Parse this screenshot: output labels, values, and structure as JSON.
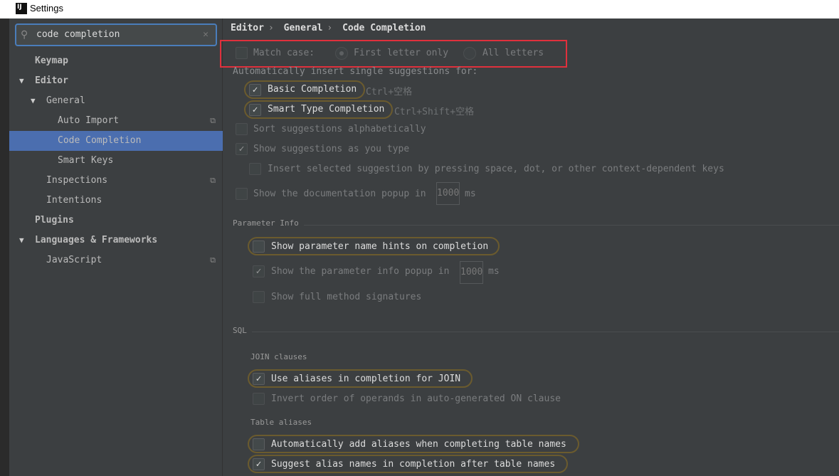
{
  "window": {
    "title": "Settings",
    "logo": "IJ"
  },
  "search": {
    "value": "code completion",
    "icon": "search-icon",
    "clear_icon": "close-icon"
  },
  "tree": [
    {
      "label": "Keymap"
    },
    {
      "label": "Editor"
    },
    {
      "label": "General"
    },
    {
      "label": "Auto Import"
    },
    {
      "label": "Code Completion",
      "selected": true
    },
    {
      "label": "Smart Keys"
    },
    {
      "label": "Inspections"
    },
    {
      "label": "Intentions"
    },
    {
      "label": "Plugins"
    },
    {
      "label": "Languages & Frameworks"
    },
    {
      "label": "JavaScript"
    }
  ],
  "breadcrumb": [
    "Editor",
    "General",
    "Code Completion"
  ],
  "breadcrumb_sep": "›",
  "match_case": {
    "label": "Match case:",
    "checked": false,
    "options": [
      "First letter only",
      "All letters"
    ],
    "selected": "First letter only"
  },
  "auto_insert": {
    "header": "Automatically insert single suggestions for:",
    "basic": {
      "label": "Basic Completion",
      "shortcut": "Ctrl+空格",
      "checked": true
    },
    "smart": {
      "label": "Smart Type Completion",
      "shortcut": "Ctrl+Shift+空格",
      "checked": true
    }
  },
  "sort": {
    "label": "Sort suggestions alphabetically",
    "checked": false
  },
  "show_as_type": {
    "label": "Show suggestions as you type",
    "checked": true
  },
  "insert_selected": {
    "label": "Insert selected suggestion by pressing space, dot, or other context-dependent keys",
    "checked": false
  },
  "doc_popup": {
    "label": "Show the documentation popup in",
    "value": "1000",
    "unit": "ms",
    "checked": false
  },
  "param_info": {
    "header": "Parameter Info",
    "name_hints": {
      "label": "Show parameter name hints on completion",
      "checked": false
    },
    "info_popup": {
      "label": "Show the parameter info popup in",
      "value": "1000",
      "unit": "ms",
      "checked": true
    },
    "full_sig": {
      "label": "Show full method signatures",
      "checked": false
    }
  },
  "sql": {
    "header": "SQL",
    "join_header": "JOIN clauses",
    "use_aliases": {
      "label": "Use aliases in completion for JOIN",
      "checked": true
    },
    "invert": {
      "label": "Invert order of operands in auto-generated ON clause",
      "checked": false
    },
    "table_header": "Table aliases",
    "auto_add": {
      "label": "Automatically add aliases when completing table names",
      "checked": false
    },
    "suggest": {
      "label": "Suggest alias names in completion after table names",
      "checked": true
    }
  },
  "check_mark": "✓",
  "colors": {
    "selection": "#4b6eaf",
    "highlight_border": "#e0303c",
    "search_border": "#4a7dbb"
  }
}
